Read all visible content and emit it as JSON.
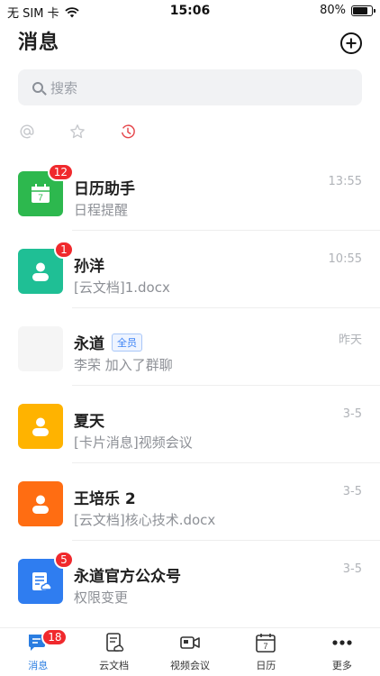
{
  "status_bar": {
    "carrier": "无 SIM 卡",
    "time": "15:06",
    "battery": "80%",
    "battery_level": 0.8
  },
  "header": {
    "title": "消息",
    "add_icon": "plus-circle-icon"
  },
  "search": {
    "placeholder": "搜索"
  },
  "filters": [
    {
      "icon": "at-icon",
      "color": "#c7c9cd"
    },
    {
      "icon": "star-icon",
      "color": "#c7c9cd"
    },
    {
      "icon": "recent-icon",
      "color": "#e5454a"
    }
  ],
  "conversations": [
    {
      "name": "日历助手",
      "preview": "日程提醒",
      "time": "13:55",
      "badge": "12",
      "avatar_color": "#2db84e",
      "avatar_icon": "calendar-icon",
      "calendar_day": "7"
    },
    {
      "name": "孙洋",
      "preview": "[云文档]1.docx",
      "time": "10:55",
      "badge": "1",
      "avatar_color": "#1fbf95",
      "avatar_icon": "person-icon"
    },
    {
      "name": "永道",
      "tag": "全员",
      "preview": "李荣 加入了群聊",
      "time": "昨天",
      "avatar_icon": "group-grid-icon"
    },
    {
      "name": "夏天",
      "preview": "[卡片消息]视频会议",
      "time": "3-5",
      "avatar_color": "#ffb300",
      "avatar_icon": "person-icon"
    },
    {
      "name": "王培乐 2",
      "preview": "[云文档]核心技术.docx",
      "time": "3-5",
      "avatar_color": "#ff6d12",
      "avatar_icon": "person-icon"
    },
    {
      "name": "永道官方公众号",
      "preview": "权限变更",
      "time": "3-5",
      "badge": "5",
      "avatar_color": "#2f7df0",
      "avatar_icon": "official-account-icon"
    }
  ],
  "tabbar": [
    {
      "label": "消息",
      "icon": "message-icon",
      "active": true,
      "badge": "18"
    },
    {
      "label": "云文档",
      "icon": "document-icon"
    },
    {
      "label": "视频会议",
      "icon": "video-icon"
    },
    {
      "label": "日历",
      "icon": "calendar-icon",
      "day": "7"
    },
    {
      "label": "更多",
      "icon": "more-icon"
    }
  ],
  "colors": {
    "accent": "#2a7de1",
    "badge": "#f0292d"
  }
}
